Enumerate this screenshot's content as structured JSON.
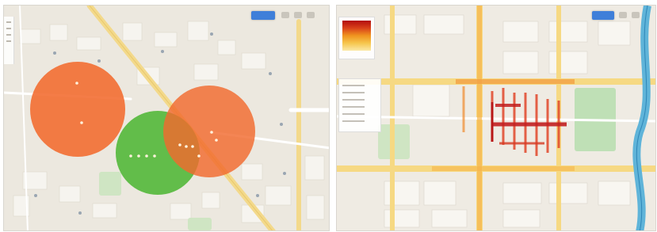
{
  "maps": [
    {
      "id": "left",
      "layer": "buffer-circles",
      "circles": [
        {
          "color": "#f26a2e",
          "count": 2
        },
        {
          "color": "#53b83a",
          "count": 4
        },
        {
          "color": "#f26a2e",
          "count": 6
        }
      ],
      "control_button_color": "#3f7fd9"
    },
    {
      "id": "right",
      "layer": "heatmap",
      "legend_colors": [
        "#b30d0d",
        "#d9411a",
        "#f0941f",
        "#f6c64d",
        "#fbe9a8"
      ],
      "control_button_color": "#3f7fd9",
      "river_color": "#5fb4d9",
      "park_color": "#bfe0b6"
    }
  ]
}
